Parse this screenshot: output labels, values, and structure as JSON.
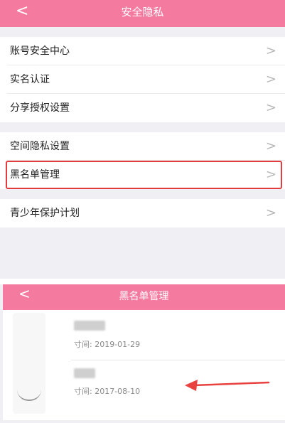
{
  "top_screen": {
    "title": "安全隐私",
    "back_glyph": "<",
    "rows": [
      {
        "label": "账号安全中心"
      },
      {
        "label": "实名认证"
      },
      {
        "label": "分享授权设置"
      },
      {
        "label": "空间隐私设置"
      },
      {
        "label": "黑名单管理"
      },
      {
        "label": "青少年保护计划"
      }
    ],
    "chevron": ">"
  },
  "bottom_screen": {
    "title": "黑名单管理",
    "back_glyph": "<",
    "entries": [
      {
        "date": "时间: 2019-01-29",
        "date_visible": "寸间: 2019-01-29"
      },
      {
        "date": "时间: 2017-08-10",
        "date_visible": "寸间: 2017-08-10"
      }
    ]
  },
  "colors": {
    "brand_pink": "#f57aa0",
    "highlight_red": "#e23c3c",
    "arrow_red": "#e8413f"
  }
}
